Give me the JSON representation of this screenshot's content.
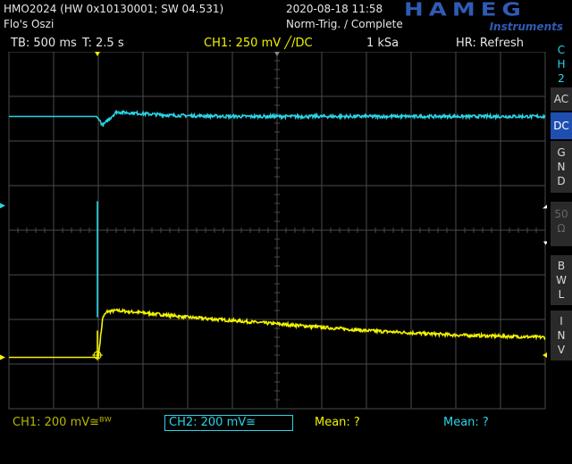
{
  "header": {
    "model": "HMO2024 (HW 0x10130001; SW 04.531)",
    "name": "Flo's Oszi",
    "datetime": "2020-08-18 11:58",
    "trigger_mode": "Norm-Trig. / Complete",
    "logo_main": "HAMEG",
    "logo_sub": "Instruments"
  },
  "status_bar": {
    "timebase": "TB: 500 ms",
    "time": "T: 2.5 s",
    "trigger": "CH1: 250 mV ╱/DC",
    "sample_rate": "1 kSa",
    "hr": "HR: Refresh"
  },
  "side_panel": {
    "channel": "C\nH\n2",
    "ac": "AC",
    "dc": "DC",
    "gnd": "G\nN\nD",
    "ohm": "50\nΩ",
    "bwl": "B\nW\nL",
    "inv": "I\nN\nV"
  },
  "footer": {
    "ch1": "CH1: 200 mV≅ᴮᵂ",
    "ch2": "CH2: 200 mV≅",
    "mean1": "Mean: ?",
    "mean2": "Mean: ?"
  },
  "colors": {
    "ch1": "#f2f200",
    "ch2": "#2ad4e6",
    "grid": "#4a4a4a",
    "accent": "#2f5bb5"
  },
  "chart_data": {
    "type": "line",
    "title": "",
    "xlabel": "",
    "ylabel": "",
    "x_divisions": 12,
    "y_divisions": 8,
    "x_unit": "s",
    "x_range": [
      -1.0,
      5.0
    ],
    "series": [
      {
        "name": "CH1",
        "unit": "mV",
        "color": "#f2f200",
        "x": [
          -1.0,
          -0.02,
          0.0,
          0.05,
          0.1,
          0.2,
          0.5,
          1.0,
          2.0,
          3.0,
          4.0,
          5.0
        ],
        "y": [
          0,
          0,
          0,
          180,
          205,
          210,
          200,
          180,
          150,
          120,
          100,
          90
        ]
      },
      {
        "name": "CH2",
        "unit": "mV",
        "color": "#2ad4e6",
        "x": [
          -1.0,
          -0.02,
          0.0,
          0.05,
          0.2,
          0.4,
          0.8,
          1.5,
          3.0,
          5.0
        ],
        "y": [
          400,
          400,
          390,
          360,
          420,
          415,
          405,
          400,
          400,
          400
        ]
      }
    ]
  }
}
